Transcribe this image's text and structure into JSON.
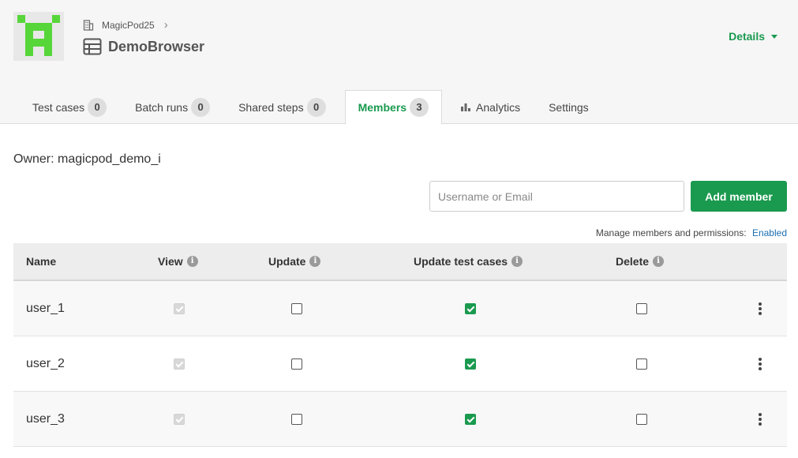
{
  "header": {
    "org_name": "MagicPod25",
    "project_name": "DemoBrowser",
    "details_label": "Details"
  },
  "tabs": [
    {
      "label": "Test cases",
      "count": "0",
      "active": false
    },
    {
      "label": "Batch runs",
      "count": "0",
      "active": false
    },
    {
      "label": "Shared steps",
      "count": "0",
      "active": false
    },
    {
      "label": "Members",
      "count": "3",
      "active": true
    },
    {
      "label": "Analytics",
      "icon": "bar-chart-icon",
      "active": false
    },
    {
      "label": "Settings",
      "active": false
    }
  ],
  "members": {
    "owner_text": "Owner: magicpod_demo_i",
    "search_placeholder": "Username or Email",
    "search_value": "",
    "add_button_label": "Add member",
    "manage_label": "Manage members and permissions:",
    "manage_status": "Enabled"
  },
  "table": {
    "headers": [
      "Name",
      "View",
      "Update",
      "Update test cases",
      "Delete"
    ],
    "rows": [
      {
        "name": "user_1",
        "view": true,
        "update": false,
        "update_test_cases": true,
        "delete": false
      },
      {
        "name": "user_2",
        "view": true,
        "update": false,
        "update_test_cases": true,
        "delete": false
      },
      {
        "name": "user_3",
        "view": true,
        "update": false,
        "update_test_cases": true,
        "delete": false
      }
    ]
  },
  "colors": {
    "accent": "#1a9a4f",
    "link": "#1b6fb2",
    "logo_green": "#57d63a"
  },
  "icons": {
    "logo": "magicpod-logo",
    "org": "building-icon",
    "project": "table-list-icon",
    "info": "info-icon",
    "row_menu": "kebab-menu-icon"
  }
}
